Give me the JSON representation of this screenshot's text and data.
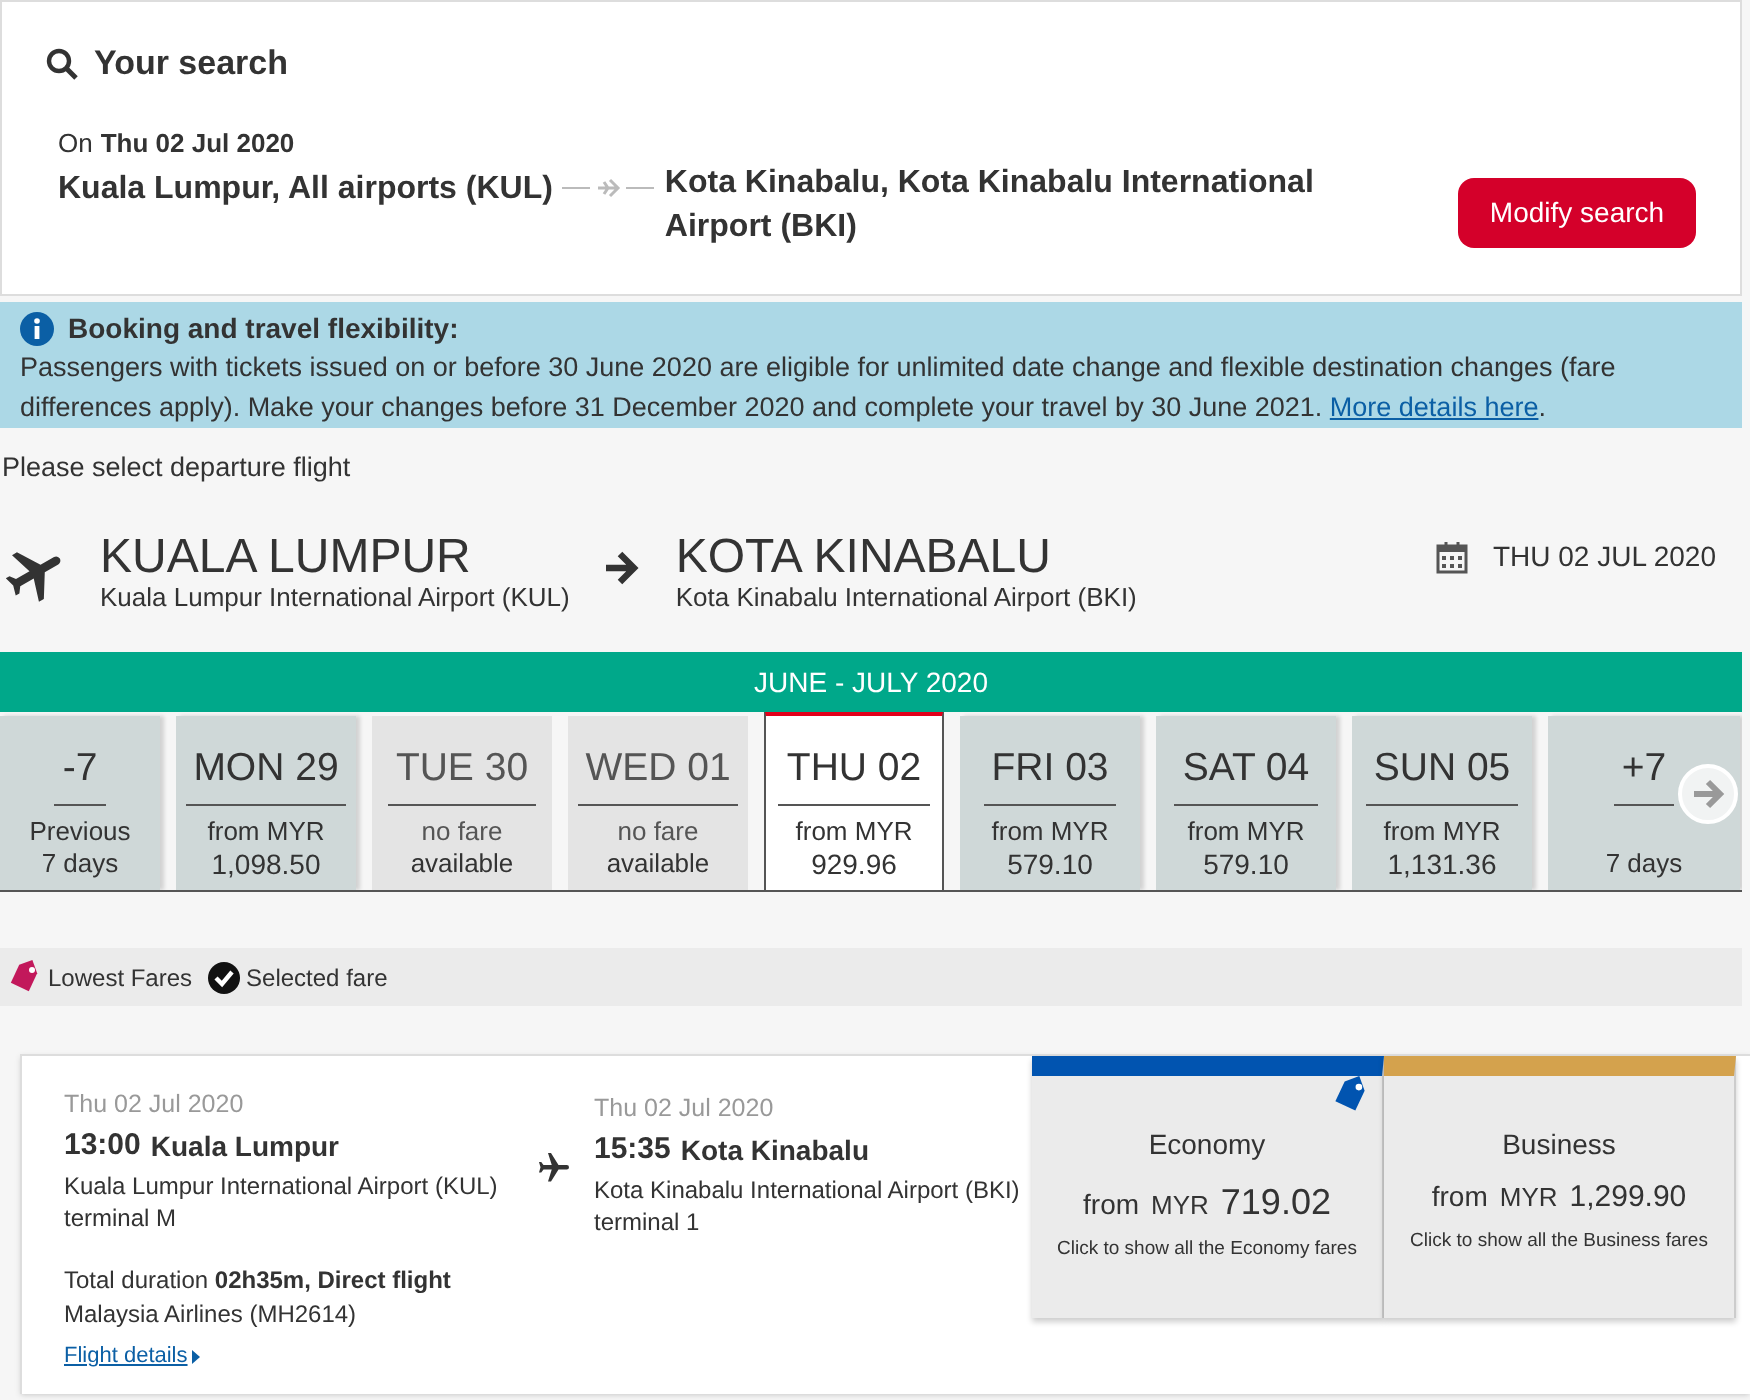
{
  "search": {
    "title": "Your search",
    "date_prefix": "On",
    "date": "Thu 02 Jul 2020",
    "origin": "Kuala Lumpur, All airports (KUL)",
    "destination": "Kota Kinabalu, Kota Kinabalu International Airport (BKI)",
    "button": "Modify search"
  },
  "notice": {
    "title": "Booking and travel flexibility:",
    "text": "Passengers with tickets issued on or before 30 June 2020 are eligible for unlimited date change and flexible destination changes (fare differences apply). Make your changes before 31 December 2020 and complete your travel by 30 June 2021. ",
    "link": "More details here",
    "after": "."
  },
  "prompt": "Please select departure flight",
  "route": {
    "from_city": "KUALA LUMPUR",
    "from_airport": "Kuala Lumpur International Airport (KUL)",
    "to_city": "KOTA KINABALU",
    "to_airport": "Kota Kinabalu International Airport (BKI)",
    "date": "THU 02 JUL 2020"
  },
  "calendar": {
    "month": "JUNE - JULY 2020",
    "days": [
      {
        "kind": "nav",
        "label": "-7",
        "line1": "Previous",
        "line2": "7 days",
        "selected": false
      },
      {
        "kind": "day",
        "label": "MON 29",
        "line1": "from MYR",
        "line2": "1,098.50",
        "selected": false
      },
      {
        "kind": "nofare",
        "label": "TUE 30",
        "line1": "no fare",
        "line2": "available",
        "selected": false
      },
      {
        "kind": "nofare",
        "label": "WED 01",
        "line1": "no fare",
        "line2": "available",
        "selected": false
      },
      {
        "kind": "day",
        "label": "THU 02",
        "line1": "from MYR",
        "line2": "929.96",
        "selected": true
      },
      {
        "kind": "day",
        "label": "FRI 03",
        "line1": "from MYR",
        "line2": "579.10",
        "selected": false
      },
      {
        "kind": "day",
        "label": "SAT 04",
        "line1": "from MYR",
        "line2": "579.10",
        "selected": false
      },
      {
        "kind": "day",
        "label": "SUN 05",
        "line1": "from MYR",
        "line2": "1,131.36",
        "selected": false
      },
      {
        "kind": "nav",
        "label": "+7",
        "line2": "7 days",
        "selected": false
      }
    ]
  },
  "legend": [
    {
      "kind": "tag",
      "label": "Lowest Fares"
    },
    {
      "kind": "check",
      "label": "Selected fare"
    }
  ],
  "flight": {
    "dep": {
      "date": "Thu 02 Jul 2020",
      "time": "13:00",
      "city": "Kuala Lumpur",
      "airport": "Kuala Lumpur International Airport (KUL)",
      "terminal": "terminal M"
    },
    "arr": {
      "date": "Thu 02 Jul 2020",
      "time": "15:35",
      "city": "Kota Kinabalu",
      "airport": "Kota Kinabalu International Airport (BKI)",
      "terminal": "terminal 1"
    },
    "duration": "Total duration **02h35m, Direct flight**",
    "airline": "Malaysia Airlines (MH2614)",
    "details": "Flight details",
    "fares": [
      {
        "cabin": "Economy",
        "from": "from",
        "currency": "MYR",
        "price": "719.02",
        "hint": "Click to show all the Economy fares",
        "color": "#0154b0",
        "lowest": true
      },
      {
        "cabin": "Business",
        "from": "from",
        "currency": "MYR",
        "price": "1,299.90",
        "hint": "Click to show all the Business fares",
        "color": "#d4a24d",
        "lowest": false
      }
    ]
  }
}
